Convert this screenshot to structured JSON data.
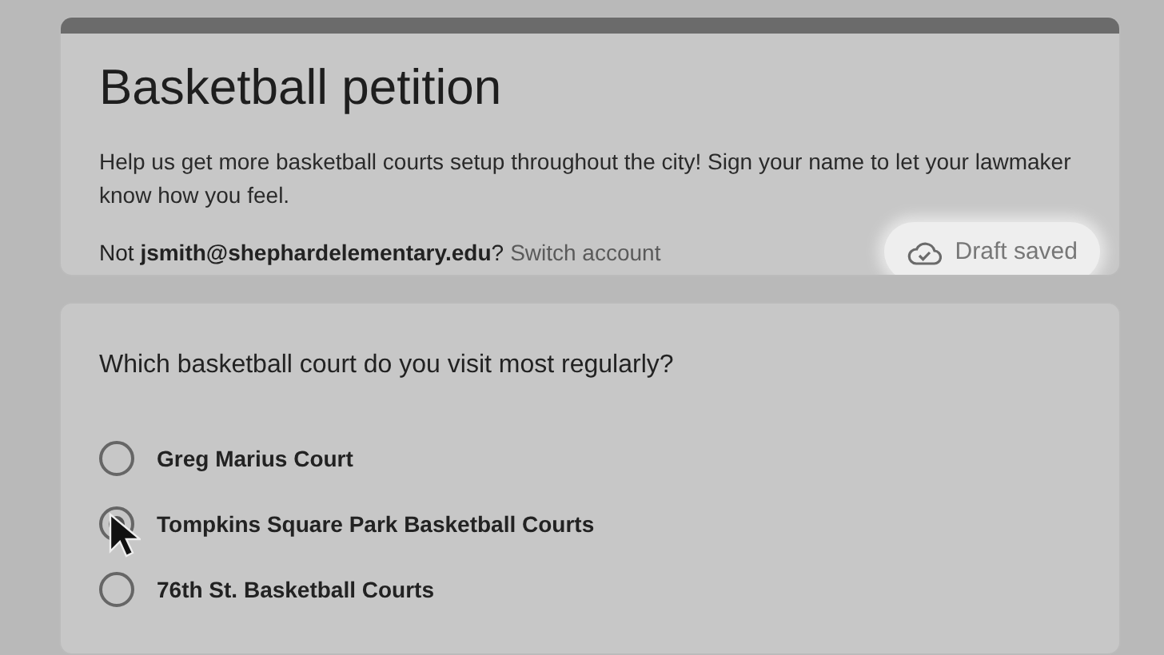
{
  "header": {
    "title": "Basketball petition",
    "description": "Help us get more basketball courts setup throughout the city! Sign your name to let your lawmaker know how you feel.",
    "account_line": "Not **jsmith@shephardelementary.edu**?",
    "switch_account": "Switch account",
    "draft_status": "Draft saved"
  },
  "question": {
    "text": "Which basketball court do you visit most regularly?",
    "options": [
      {
        "label": "Greg Marius Court",
        "selected": false
      },
      {
        "label": "Tompkins Square Park Basketball Courts",
        "selected": true
      },
      {
        "label": "76th St. Basketball Courts",
        "selected": false
      }
    ]
  }
}
